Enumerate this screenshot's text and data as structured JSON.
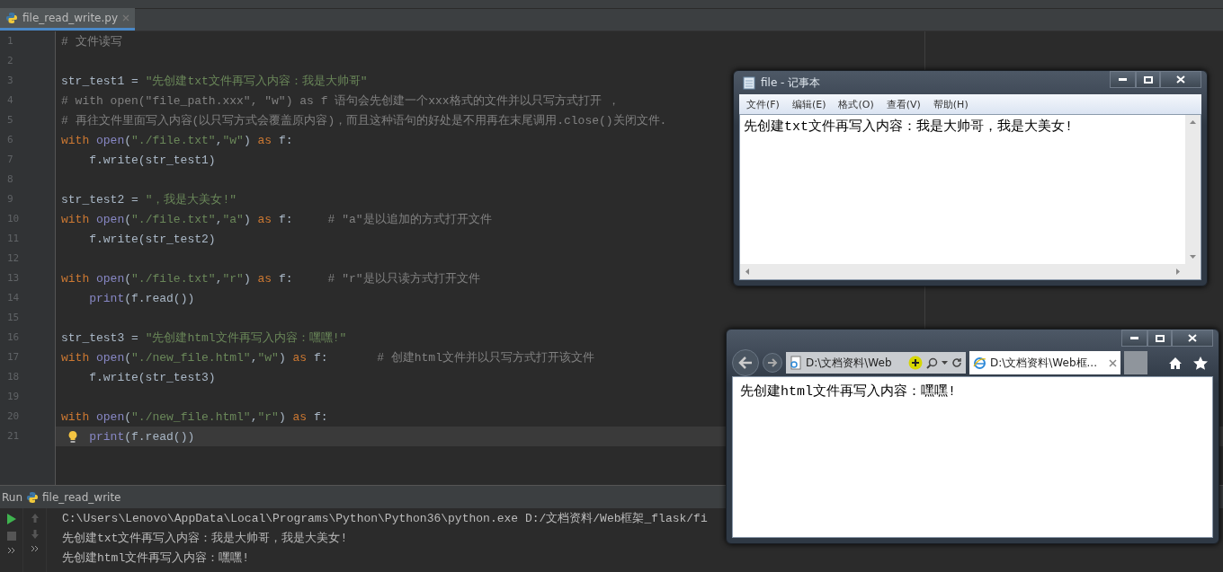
{
  "editor_tab": {
    "label": "file_read_write.py",
    "selected": true
  },
  "code_lines": [
    {
      "number": "1",
      "current": false,
      "tokens": [
        {
          "kind": "comment",
          "text": "# 文件读写"
        }
      ]
    },
    {
      "number": "2",
      "current": false
    },
    {
      "number": "3",
      "current": false,
      "tokens": [
        {
          "kind": "plain",
          "text": "str_test1 = "
        },
        {
          "kind": "string",
          "text": "\"先创建txt文件再写入内容：我是大帅哥\""
        }
      ]
    },
    {
      "number": "4",
      "current": false,
      "tokens": [
        {
          "kind": "comment",
          "text": "# with open(\"file_path.xxx\", \"w\") as f 语句会先创建一个xxx格式的文件并以只写方式打开 ，"
        }
      ]
    },
    {
      "number": "5",
      "current": false,
      "tokens": [
        {
          "kind": "comment",
          "text": "# 再往文件里面写入内容(以只写方式会覆盖原内容)，而且这种语句的好处是不用再在末尾调用.close()关闭文件."
        }
      ]
    },
    {
      "number": "6",
      "current": false,
      "tokens": [
        {
          "kind": "keyword",
          "text": "with"
        },
        {
          "kind": "builtin",
          "text": " open"
        },
        {
          "kind": "plain",
          "text": "("
        },
        {
          "kind": "string",
          "text": "\"./file.txt\""
        },
        {
          "kind": "plain",
          "text": ","
        },
        {
          "kind": "string",
          "text": "\"w\""
        },
        {
          "kind": "plain",
          "text": ") "
        },
        {
          "kind": "keyword",
          "text": "as"
        },
        {
          "kind": "plain",
          "text": " f:"
        }
      ]
    },
    {
      "number": "7",
      "current": false,
      "tokens": [
        {
          "kind": "plain",
          "text": "    f.write(str_test1)"
        }
      ]
    },
    {
      "number": "8",
      "current": false
    },
    {
      "number": "9",
      "current": false,
      "tokens": [
        {
          "kind": "plain",
          "text": "str_test2 = "
        },
        {
          "kind": "string",
          "text": "\"，我是大美女!\""
        }
      ]
    },
    {
      "number": "10",
      "current": false,
      "tokens": [
        {
          "kind": "keyword",
          "text": "with"
        },
        {
          "kind": "builtin",
          "text": " open"
        },
        {
          "kind": "plain",
          "text": "("
        },
        {
          "kind": "string",
          "text": "\"./file.txt\""
        },
        {
          "kind": "plain",
          "text": ","
        },
        {
          "kind": "string",
          "text": "\"a\""
        },
        {
          "kind": "plain",
          "text": ") "
        },
        {
          "kind": "keyword",
          "text": "as"
        },
        {
          "kind": "plain",
          "text": " f:     "
        },
        {
          "kind": "comment",
          "text": "# \"a\"是以追加的方式打开文件"
        }
      ]
    },
    {
      "number": "11",
      "current": false,
      "tokens": [
        {
          "kind": "plain",
          "text": "    f.write(str_test2)"
        }
      ]
    },
    {
      "number": "12",
      "current": false
    },
    {
      "number": "13",
      "current": false,
      "tokens": [
        {
          "kind": "keyword",
          "text": "with"
        },
        {
          "kind": "builtin",
          "text": " open"
        },
        {
          "kind": "plain",
          "text": "("
        },
        {
          "kind": "string",
          "text": "\"./file.txt\""
        },
        {
          "kind": "plain",
          "text": ","
        },
        {
          "kind": "string",
          "text": "\"r\""
        },
        {
          "kind": "plain",
          "text": ") "
        },
        {
          "kind": "keyword",
          "text": "as"
        },
        {
          "kind": "plain",
          "text": " f:     "
        },
        {
          "kind": "comment",
          "text": "# \"r\"是以只读方式打开文件"
        }
      ]
    },
    {
      "number": "14",
      "current": false,
      "tokens": [
        {
          "kind": "builtin",
          "text": "    print"
        },
        {
          "kind": "plain",
          "text": "(f.read())"
        }
      ]
    },
    {
      "number": "15",
      "current": false
    },
    {
      "number": "16",
      "current": false,
      "tokens": [
        {
          "kind": "plain",
          "text": "str_test3 = "
        },
        {
          "kind": "string",
          "text": "\"先创建html文件再写入内容：嘿嘿!\""
        }
      ]
    },
    {
      "number": "17",
      "current": false,
      "tokens": [
        {
          "kind": "keyword",
          "text": "with"
        },
        {
          "kind": "builtin",
          "text": " open"
        },
        {
          "kind": "plain",
          "text": "("
        },
        {
          "kind": "string",
          "text": "\"./new_file.html\""
        },
        {
          "kind": "plain",
          "text": ","
        },
        {
          "kind": "string",
          "text": "\"w\""
        },
        {
          "kind": "plain",
          "text": ") "
        },
        {
          "kind": "keyword",
          "text": "as"
        },
        {
          "kind": "plain",
          "text": " f:       "
        },
        {
          "kind": "comment",
          "text": "# 创建html文件并以只写方式打开该文件"
        }
      ]
    },
    {
      "number": "18",
      "current": false,
      "tokens": [
        {
          "kind": "plain",
          "text": "    f.write(str_test3)"
        }
      ]
    },
    {
      "number": "19",
      "current": false
    },
    {
      "number": "20",
      "current": false,
      "tokens": [
        {
          "kind": "keyword",
          "text": "with"
        },
        {
          "kind": "builtin",
          "text": " open"
        },
        {
          "kind": "plain",
          "text": "("
        },
        {
          "kind": "string",
          "text": "\"./new_file.html\""
        },
        {
          "kind": "plain",
          "text": ","
        },
        {
          "kind": "string",
          "text": "\"r\""
        },
        {
          "kind": "plain",
          "text": ") "
        },
        {
          "kind": "keyword",
          "text": "as"
        },
        {
          "kind": "plain",
          "text": " f:"
        }
      ]
    },
    {
      "number": "21",
      "current": true,
      "tokens": [
        {
          "kind": "builtin",
          "text": "    print"
        },
        {
          "kind": "plain",
          "text": "(f.read())"
        }
      ]
    }
  ],
  "run_panel": {
    "label": "Run",
    "config": "file_read_write",
    "output": [
      "C:\\Users\\Lenovo\\AppData\\Local\\Programs\\Python\\Python36\\python.exe D:/文档资料/Web框架_flask/fi",
      "先创建txt文件再写入内容：我是大帅哥，我是大美女!",
      "先创建html文件再写入内容：嘿嘿!"
    ]
  },
  "notepad": {
    "title": "file - 记事本",
    "menu": [
      "文件(F)",
      "编辑(E)",
      "格式(O)",
      "查看(V)",
      "帮助(H)"
    ],
    "content": "先创建txt文件再写入内容：我是大帅哥，我是大美女!"
  },
  "browser": {
    "address": "D:\\文档资料\\Web",
    "tab": "D:\\文档资料\\Web框...",
    "content": "先创建html文件再写入内容：嘿嘿!"
  }
}
